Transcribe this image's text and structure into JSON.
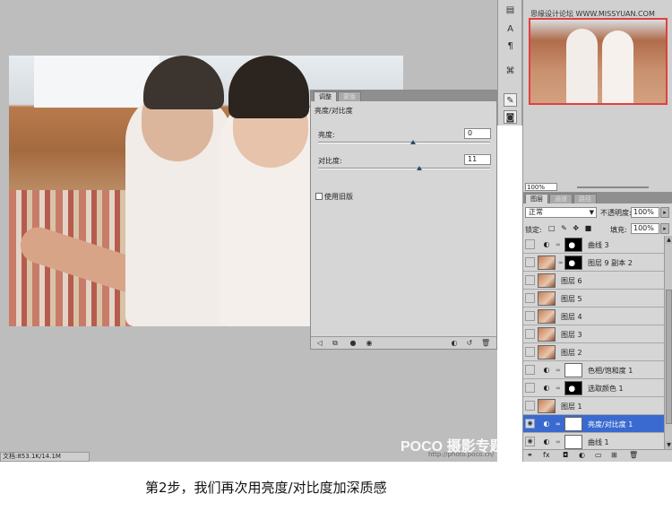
{
  "adjustments_panel": {
    "tabs": [
      "调整",
      "蒙版"
    ],
    "title": "亮度/对比度",
    "brightness_label": "亮度:",
    "brightness_value": "0",
    "brightness_level": 0.55,
    "contrast_label": "对比度:",
    "contrast_value": "11",
    "contrast_level": 0.59,
    "legacy_label": "使用旧版"
  },
  "navigator": {
    "watermark": "思缘设计论坛 WWW.MISSYUAN.COM",
    "zoom": "100%"
  },
  "layers_panel": {
    "tabs": [
      "图层",
      "通道",
      "路径"
    ],
    "blend_mode": "正常",
    "opacity_label": "不透明度:",
    "opacity_value": "100%",
    "lock_label": "锁定:",
    "fill_label": "填充:",
    "fill_value": "100%",
    "layers": [
      {
        "name": "曲线 3",
        "type": "adjustment",
        "mask": "dark",
        "visible": false,
        "selected": false
      },
      {
        "name": "图层 9 副本 2",
        "type": "pixel",
        "mask": "dark",
        "visible": false,
        "selected": false
      },
      {
        "name": "图层 6",
        "type": "pixel",
        "visible": false,
        "selected": false
      },
      {
        "name": "图层 5",
        "type": "pixel",
        "visible": false,
        "selected": false
      },
      {
        "name": "图层 4",
        "type": "pixel",
        "visible": false,
        "selected": false
      },
      {
        "name": "图层 3",
        "type": "pixel",
        "visible": false,
        "selected": false
      },
      {
        "name": "图层 2",
        "type": "pixel",
        "visible": false,
        "selected": false
      },
      {
        "name": "色相/饱和度 1",
        "type": "adjustment",
        "mask": "white",
        "visible": false,
        "selected": false
      },
      {
        "name": "选取颜色 1",
        "type": "adjustment",
        "mask": "dark",
        "visible": false,
        "selected": false
      },
      {
        "name": "图层 1",
        "type": "pixel",
        "visible": false,
        "selected": false
      },
      {
        "name": "亮度/对比度 1",
        "type": "adjustment",
        "mask": "white",
        "visible": true,
        "selected": true
      },
      {
        "name": "曲线 1",
        "type": "adjustment",
        "mask": "white",
        "visible": true,
        "selected": false
      }
    ]
  },
  "status_bar": {
    "doc_size": "文档:853.1K/14.1M"
  },
  "watermark": {
    "brand": "POCO 摄影专题",
    "url": "http://photo.poco.cn/"
  },
  "caption": "第2步，我们再次用亮度/对比度加深质感"
}
